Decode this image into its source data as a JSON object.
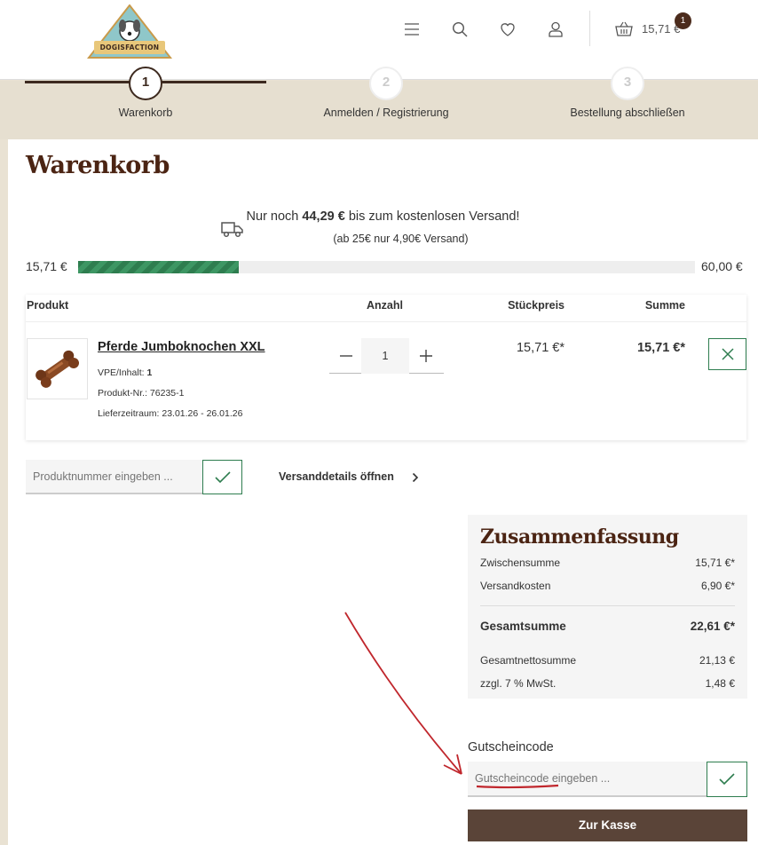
{
  "header": {
    "logo_text": "DOGISFACTION",
    "cart_total": "15,71 €",
    "cart_count": "1",
    "icons": [
      "menu-icon",
      "search-icon",
      "heart-icon",
      "user-icon",
      "basket-icon"
    ]
  },
  "steps": [
    {
      "number": "1",
      "label": "Warenkorb",
      "active": true
    },
    {
      "number": "2",
      "label": "Anmelden / Registrierung",
      "active": false
    },
    {
      "number": "3",
      "label": "Bestellung abschließen",
      "active": false
    }
  ],
  "page": {
    "title": "Warenkorb"
  },
  "shipping": {
    "prefix": "Nur noch",
    "amount": "44,29 €",
    "suffix": "bis zum kostenlosen Versand!",
    "sub": "(ab 25€ nur 4,90€ Versand)",
    "progress_start": "15,71 €",
    "progress_end": "60,00 €",
    "progress_fraction": 0.26
  },
  "table": {
    "headers": {
      "product": "Produkt",
      "qty": "Anzahl",
      "unit": "Stückpreis",
      "sum": "Summe"
    },
    "items": [
      {
        "name": "Pferde Jumboknochen XXL",
        "vpe_label": "VPE/Inhalt:",
        "vpe_value": "1",
        "product_no": "Produkt-Nr.: 76235-1",
        "delivery": "Lieferzeitraum: 23.01.26 - 26.01.26",
        "quantity": "1",
        "unit_price": "15,71 €*",
        "sum": "15,71 €*"
      }
    ]
  },
  "product_number": {
    "placeholder": "Produktnummer eingeben ..."
  },
  "shipping_details_label": "Versanddetails öffnen",
  "summary": {
    "title": "Zusammenfassung",
    "rows": [
      {
        "label": "Zwischensumme",
        "value": "15,71 €*"
      },
      {
        "label": "Versandkosten",
        "value": "6,90 €*"
      }
    ],
    "total": {
      "label": "Gesamtsumme",
      "value": "22,61 €*"
    },
    "net": [
      {
        "label": "Gesamtnettosumme",
        "value": "21,13 €"
      },
      {
        "label": "zzgl. 7 % MwSt.",
        "value": "1,48 €"
      }
    ]
  },
  "coupon": {
    "label": "Gutscheincode",
    "placeholder": "Gutscheincode eingeben ..."
  },
  "checkout_label": "Zur Kasse",
  "colors": {
    "brand_brown": "#4b2413",
    "accent_green": "#2e7d4f",
    "button_brown": "#5a4438",
    "annotation_red": "#c0272d"
  }
}
